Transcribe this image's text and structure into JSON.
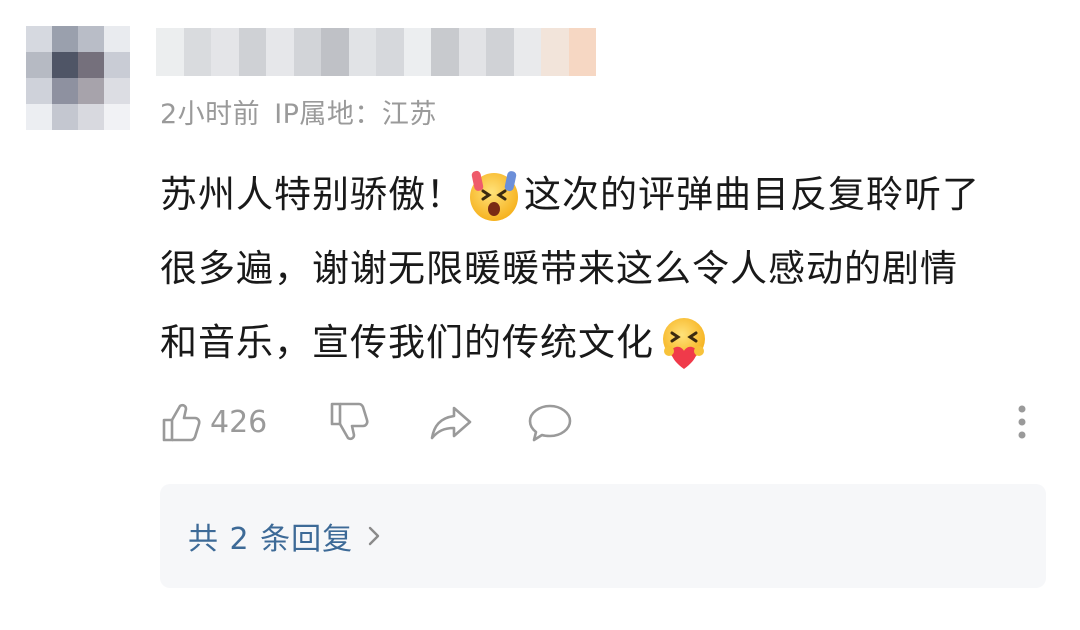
{
  "comment": {
    "time": "2小时前",
    "ip_location": "IP属地：江苏",
    "body_lines": [
      [
        "苏州人特别骄傲！",
        "这次的评弹曲目反复聆听了"
      ],
      [
        "很多遍，谢谢无限暖暖带来这么令人感动的剧情"
      ],
      [
        "和音乐，宣传我们的传统文化"
      ]
    ],
    "body_text": {
      "line1_a": "苏州人特别骄傲！",
      "line1_b": "这次的评弹曲目反复聆听了",
      "line2": "很多遍，谢谢无限暖暖带来这么令人感动的剧情",
      "line3": "和音乐，宣传我们的传统文化"
    },
    "emojis": [
      "shocked-emoji-icon",
      "heart-hug-emoji-icon"
    ],
    "like_count": "426",
    "replies_label": "共 2 条回复"
  },
  "colors": {
    "meta_gray": "#9a9a9a",
    "text": "#191919",
    "reply_link": "#3d6a97",
    "reply_bg": "#f6f7f9"
  }
}
